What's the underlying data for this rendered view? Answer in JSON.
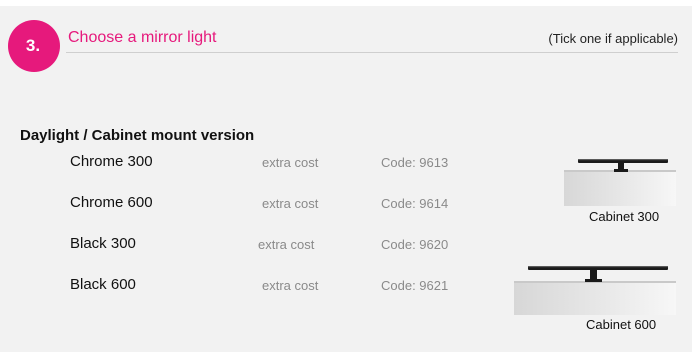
{
  "header": {
    "step_number": "3.",
    "title": "Choose a mirror light",
    "note": "(Tick one if applicable)"
  },
  "section": {
    "title": "Daylight / Cabinet mount version"
  },
  "options": [
    {
      "name": "Chrome 300",
      "cost": "extra cost",
      "code": "Code: 9613"
    },
    {
      "name": "Chrome 600",
      "cost": "extra cost",
      "code": "Code: 9614"
    },
    {
      "name": "Black 300",
      "cost": "extra cost",
      "code": "Code: 9620"
    },
    {
      "name": "Black 600",
      "cost": "extra cost",
      "code": "Code: 9621"
    }
  ],
  "products": [
    {
      "caption": "Cabinet 300",
      "icon": "cabinet-light-300-image"
    },
    {
      "caption": "Cabinet 600",
      "icon": "cabinet-light-600-image"
    }
  ],
  "colors": {
    "accent": "#e6197c",
    "muted_text": "#8a8a8a",
    "background": "#f2f2f2"
  }
}
